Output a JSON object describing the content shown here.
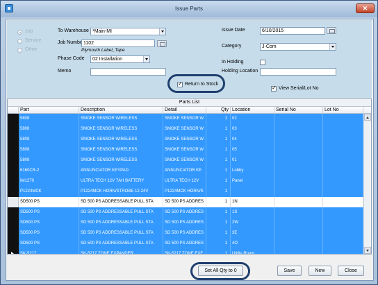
{
  "window": {
    "title": "Issue Parts"
  },
  "job_type": {
    "job_label": "Job",
    "service_label": "Service",
    "other_label": "Other",
    "selected": "Job"
  },
  "form": {
    "to_warehouse_label": "To Warehouse",
    "to_warehouse_value": "*Main-MI",
    "job_number_label": "Job Number",
    "job_number_value": "1102",
    "job_name": "Plymouth Label_Tape",
    "phase_code_label": "Phase Code",
    "phase_code_value": "02 Installation",
    "memo_label": "Memo",
    "memo_value": "",
    "return_to_stock_label": "Return to Stock",
    "return_to_stock_checked": true,
    "issue_date_label": "Issue Date",
    "issue_date_value": "6/10/2015",
    "category_label": "Category",
    "category_value": "J-Com",
    "in_holding_label": "In Holding",
    "in_holding_checked": false,
    "holding_location_label": "Holding Location",
    "holding_location_value": "",
    "view_serial_label": "View Serial/Lot No",
    "view_serial_checked": true
  },
  "parts_list": {
    "caption": "Parts List",
    "columns": [
      "Part",
      "Description",
      "Detail",
      "Qty",
      "Location",
      "Serial No",
      "Lot No"
    ],
    "rows": [
      {
        "part": "5808",
        "description": "SMOKE SENSOR WIRELESS",
        "detail": "SMOKE SENSOR W",
        "qty": "1",
        "location": "02",
        "serial": "",
        "lot": "",
        "selected": true
      },
      {
        "part": "5808",
        "description": "SMOKE SENSOR WIRELESS",
        "detail": "SMOKE SENSOR W",
        "qty": "1",
        "location": "03",
        "serial": "",
        "lot": "",
        "selected": true
      },
      {
        "part": "5808",
        "description": "SMOKE SENSOR WIRELESS",
        "detail": "SMOKE SENSOR W",
        "qty": "1",
        "location": "04",
        "serial": "",
        "lot": "",
        "selected": true
      },
      {
        "part": "5808",
        "description": "SMOKE SENSOR WIRELESS",
        "detail": "SMOKE SENSOR W",
        "qty": "1",
        "location": "05",
        "serial": "",
        "lot": "",
        "selected": true
      },
      {
        "part": "5808",
        "description": "SMOKE SENSOR WIRELESS",
        "detail": "SMOKE SENSOR W",
        "qty": "1",
        "location": "01",
        "serial": "",
        "lot": "",
        "selected": true
      },
      {
        "part": "6160CR-2",
        "description": "ANNUNCIATOR KEYPAD",
        "detail": "ANNUNCIATOR KE",
        "qty": "1",
        "location": "Lobby",
        "serial": "",
        "lot": "",
        "selected": true
      },
      {
        "part": "IM1270",
        "description": "ULTRA TECH 12V 7AH BATTERY",
        "detail": "ULTRA TECH 12V",
        "qty": "1",
        "location": "Panel",
        "serial": "",
        "lot": "",
        "selected": true
      },
      {
        "part": "P1224MCK",
        "description": "P1224MCK HORN/STROBE 12-24V",
        "detail": "P1224MCK HORN/S",
        "qty": "1",
        "location": "",
        "serial": "",
        "lot": "",
        "selected": true
      },
      {
        "part": "SD500 PS",
        "description": "SD 500 PS ADDRESSABLE PULL STA",
        "detail": "SD 500 PS ADDRES",
        "qty": "1",
        "location": "1N",
        "serial": "",
        "lot": "",
        "selected": false
      },
      {
        "part": "SD500 PS",
        "description": "SD 500 PS ADDRESSABLE PULL STA",
        "detail": "SD 500 PS ADDRES",
        "qty": "1",
        "location": "1S",
        "serial": "",
        "lot": "",
        "selected": true
      },
      {
        "part": "SD500 PS",
        "description": "SD 500 PS ADDRESSABLE PULL STA",
        "detail": "SD 500 PS ADDRES",
        "qty": "1",
        "location": "2W",
        "serial": "",
        "lot": "",
        "selected": true
      },
      {
        "part": "SD500 PS",
        "description": "SD 500 PS ADDRESSABLE PULL STA",
        "detail": "SD 500 PS ADDRES",
        "qty": "1",
        "location": "3E",
        "serial": "",
        "lot": "",
        "selected": true
      },
      {
        "part": "SD500 PS",
        "description": "SD 500 PS ADDRESSABLE PULL STA",
        "detail": "SD 500 PS ADDRES",
        "qty": "1",
        "location": "4O",
        "serial": "",
        "lot": "",
        "selected": true
      },
      {
        "part": "SK-5217",
        "description": "SK-5217 ZONE EXPANDER",
        "detail": "SK-5217 ZONE EXF",
        "qty": "1",
        "location": "Utility Room",
        "serial": "",
        "lot": "",
        "selected": true,
        "current": true
      }
    ]
  },
  "buttons": {
    "set_all_qty": "Set All Qty to 0",
    "save": "Save",
    "new": "New",
    "close": "Close"
  },
  "colors": {
    "selection": "#3399ff",
    "panel": "#c6dcea",
    "highlight_oval": "#1f3f6e"
  }
}
